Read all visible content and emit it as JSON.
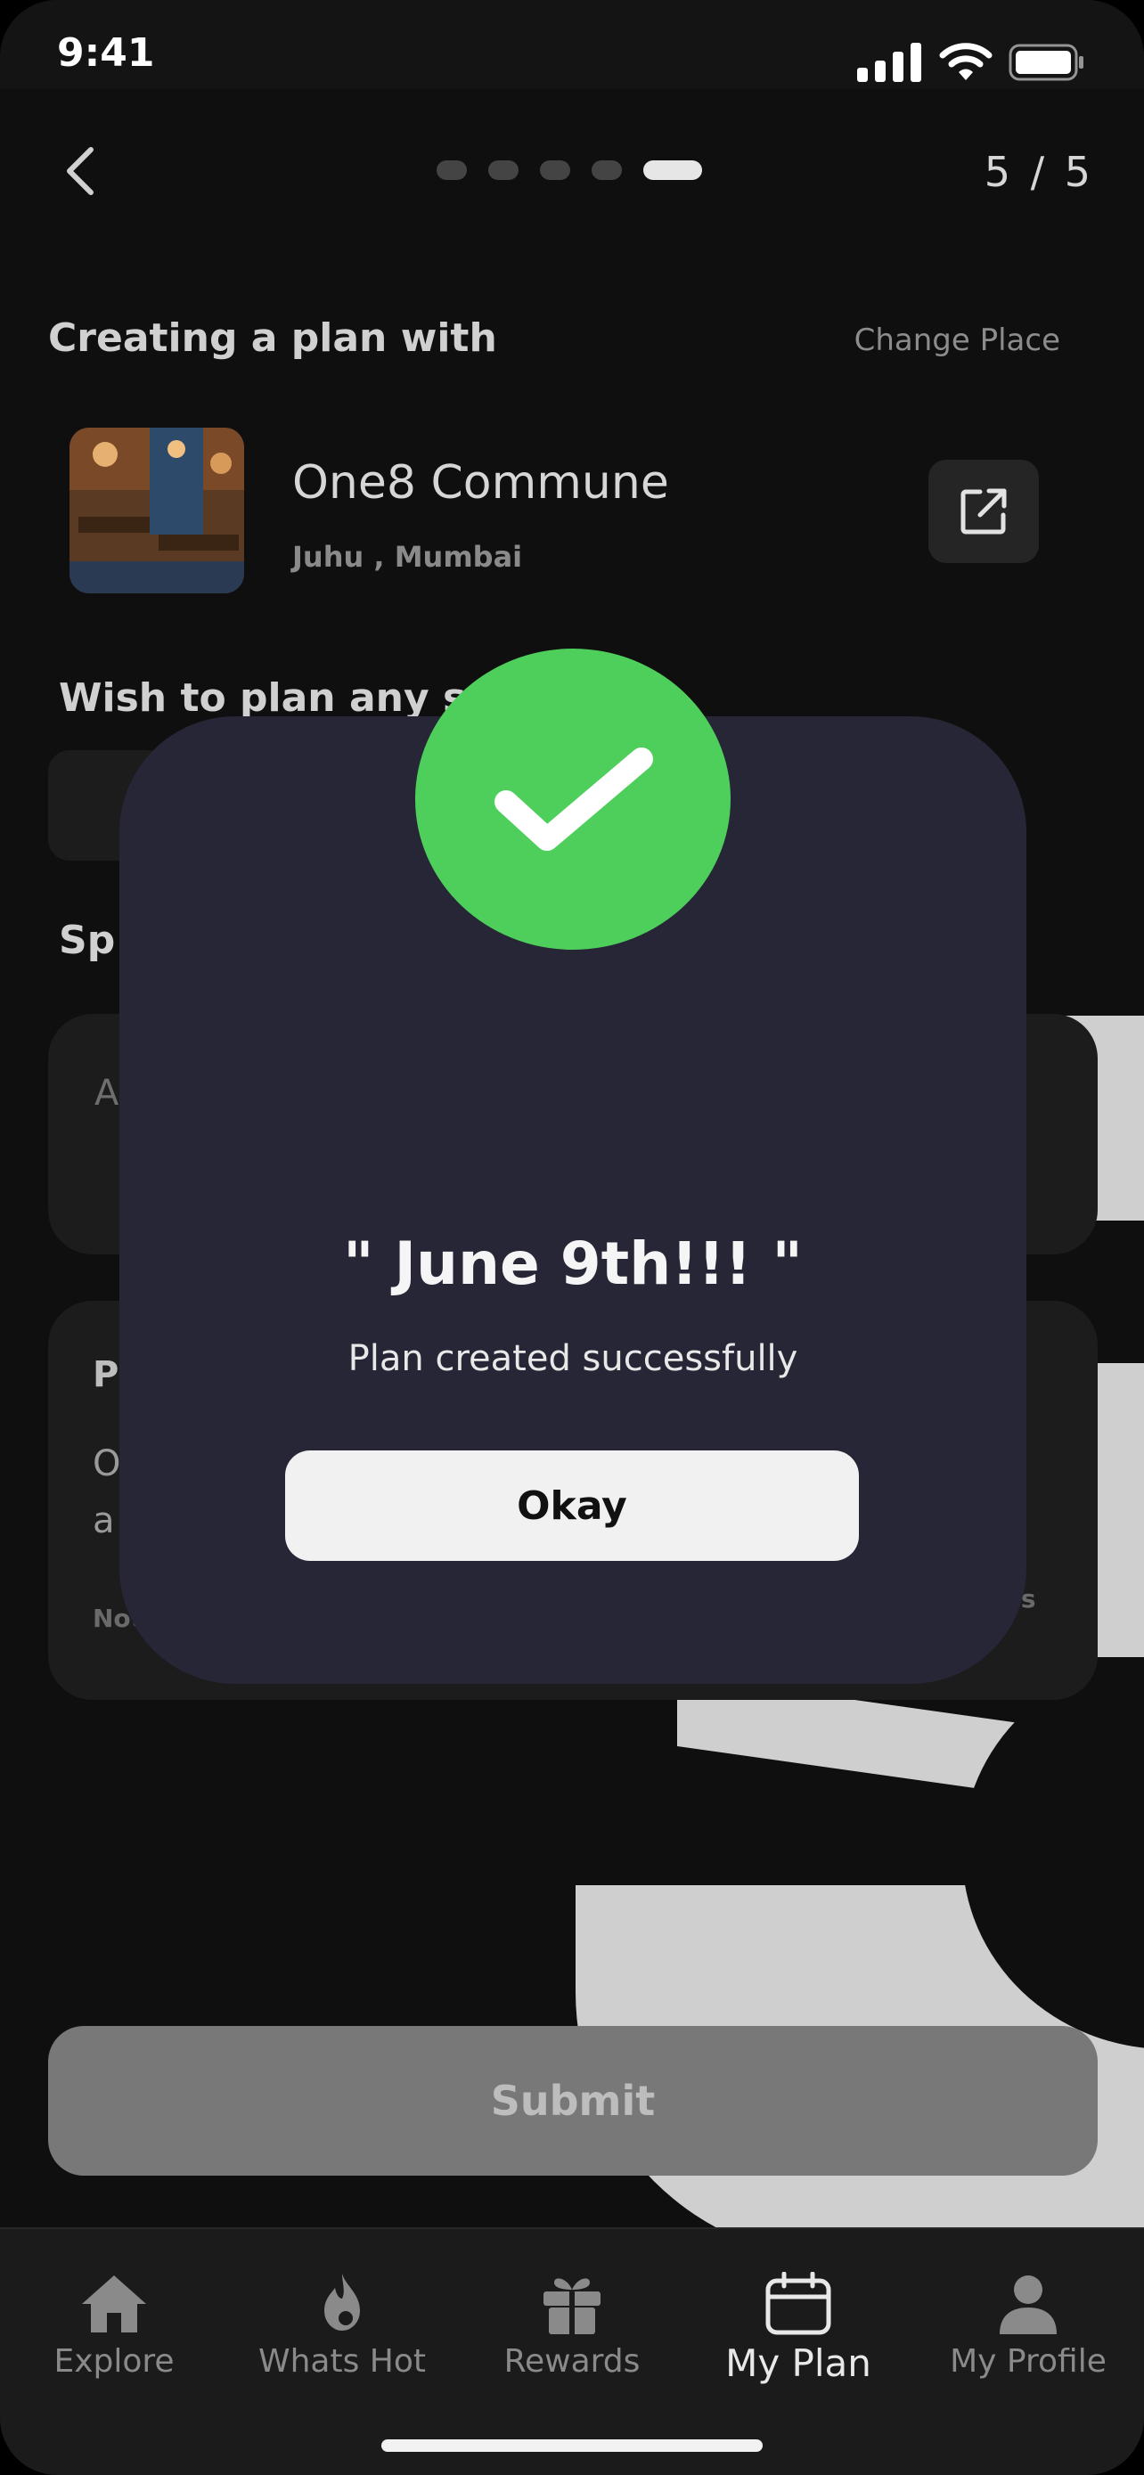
{
  "status_bar": {
    "time": "9:41"
  },
  "header": {
    "step_counter": "5 / 5",
    "steps_total": 5,
    "steps_done": 5
  },
  "plan_section": {
    "title": "Creating a plan with",
    "change_place_label": "Change Place"
  },
  "place": {
    "name": "One8 Commune",
    "location": "Juhu , Mumbai"
  },
  "background_fragments": {
    "wish_heading": "Wish to plan any s",
    "special_prefix": "Sp",
    "input_prefix": "A",
    "card_heading_prefix": "P",
    "card_line1_prefix": "O",
    "card_line2_prefix": "a",
    "note_prefix": "Not",
    "note_suffix": "ns"
  },
  "submit_label": "Submit",
  "modal": {
    "title": "\" June 9th!!! \"",
    "subtitle": "Plan created successfully",
    "okay_label": "Okay",
    "accent_color": "#4ecf5c"
  },
  "tab_bar": {
    "tabs": [
      {
        "label": "Explore",
        "icon": "home-icon"
      },
      {
        "label": "Whats Hot",
        "icon": "flame-icon"
      },
      {
        "label": "Rewards",
        "icon": "gift-icon"
      },
      {
        "label": "My Plan",
        "icon": "calendar-icon",
        "active": true
      },
      {
        "label": "My Profile",
        "icon": "profile-icon"
      }
    ]
  }
}
